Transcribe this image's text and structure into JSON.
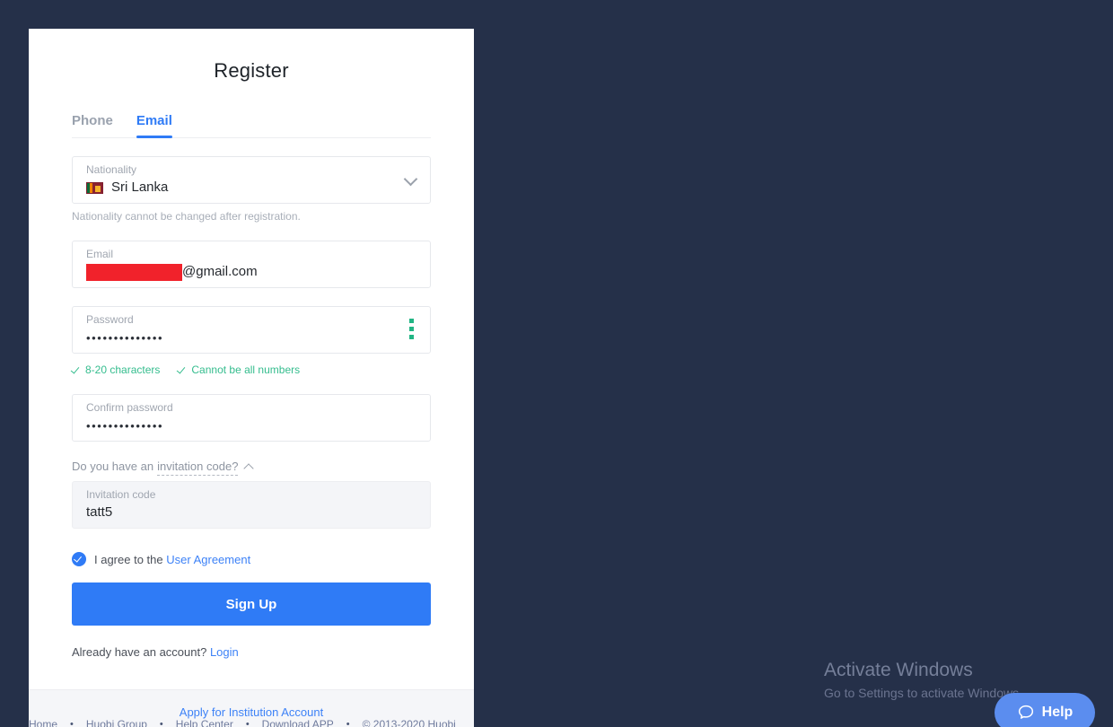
{
  "page": {
    "background_color": "#253049",
    "accent_color": "#2f7bf6",
    "success_color": "#35bd8e"
  },
  "card": {
    "title": "Register",
    "tabs": [
      {
        "label": "Phone",
        "active": false
      },
      {
        "label": "Email",
        "active": true
      }
    ],
    "nationality": {
      "label": "Nationality",
      "value": "Sri Lanka",
      "flag": "sri-lanka-flag",
      "hint": "Nationality cannot be changed after registration."
    },
    "email": {
      "label": "Email",
      "redacted": true,
      "value_visible": "@gmail.com",
      "redaction_color": "#f1222b"
    },
    "password": {
      "label": "Password",
      "value_masked": "••••••••••••••",
      "strength_indicator": "strength-3-dots",
      "strength_color": "#22b584",
      "rules": [
        {
          "label": "8-20 characters",
          "satisfied": true
        },
        {
          "label": "Cannot be all numbers",
          "satisfied": true
        }
      ]
    },
    "confirm_password": {
      "label": "Confirm password",
      "value_masked": "••••••••••••••"
    },
    "invitation": {
      "toggle_prefix": "Do you have an ",
      "toggle_link": "invitation code?",
      "expanded": true,
      "field_label": "Invitation code",
      "field_value": "tatt5"
    },
    "agreement": {
      "checked": true,
      "text": "I agree to the",
      "link_label": "User Agreement"
    },
    "submit_label": "Sign Up",
    "login_prompt": "Already have an account?",
    "login_link": "Login",
    "footer_link": "Apply for Institution Account"
  },
  "page_footer": {
    "links": [
      "Home",
      "Huobi Group",
      "Help Center",
      "Download APP"
    ],
    "separator": "•",
    "copyright": "© 2013-2020 Huobi"
  },
  "watermark": {
    "title": "Activate Windows",
    "subtitle": "Go to Settings to activate Windows."
  },
  "help_widget": {
    "label": "Help",
    "icon": "chat-bubble-icon",
    "color": "#5b8def"
  }
}
